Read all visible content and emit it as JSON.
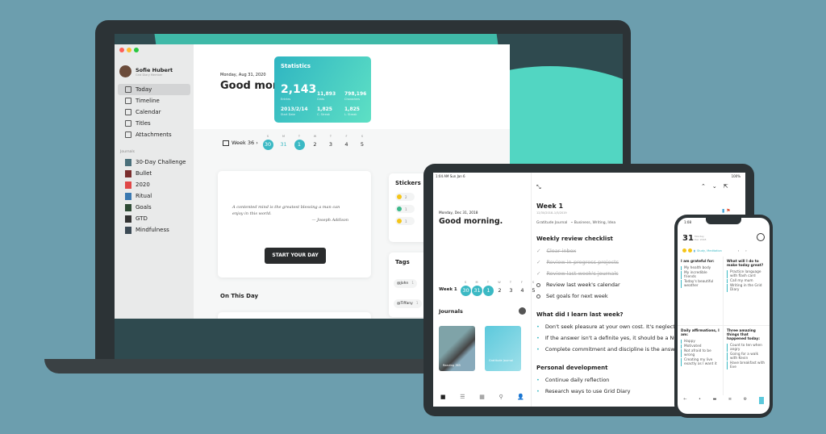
{
  "colors": {
    "background": "#6c9eae",
    "accent": "#3bb9c4",
    "bezel": "#2c3336"
  },
  "mac": {
    "window_controls": [
      "#fe5f57",
      "#febc2e",
      "#28c840"
    ],
    "user": {
      "name": "Sofie Hubert",
      "subtitle": "Grid Diary Member"
    },
    "nav": [
      {
        "label": "Today",
        "icon": "bookmark-icon",
        "active": true
      },
      {
        "label": "Timeline",
        "icon": "list-icon"
      },
      {
        "label": "Calendar",
        "icon": "calendar-icon"
      },
      {
        "label": "Titles",
        "icon": "sparkle-icon"
      },
      {
        "label": "Attachments",
        "icon": "image-icon"
      }
    ],
    "journals_heading": "Journals",
    "journals": [
      {
        "label": "30-Day Challenge",
        "color": "#4a6f7a"
      },
      {
        "label": "Bullet",
        "color": "#7a2e2e"
      },
      {
        "label": "2020",
        "color": "#e04848"
      },
      {
        "label": "Ritual",
        "color": "#3a78b0"
      },
      {
        "label": "Goals",
        "color": "#2d4a34"
      },
      {
        "label": "GTD",
        "color": "#333"
      },
      {
        "label": "Mindfulness",
        "color": "#3c4a55"
      }
    ],
    "date": "Monday, Aug 31, 2020",
    "greeting": "Good morning.",
    "week_label": "Week 36",
    "week_days": [
      {
        "l": "S",
        "d": "30",
        "sel": true
      },
      {
        "l": "M",
        "d": "31",
        "accent": true
      },
      {
        "l": "T",
        "d": "1",
        "sel": true
      },
      {
        "l": "W",
        "d": "2"
      },
      {
        "l": "T",
        "d": "3"
      },
      {
        "l": "F",
        "d": "4"
      },
      {
        "l": "S",
        "d": "5"
      }
    ],
    "quote": "A contented mind is the greatest blessing a man can enjoy in this world.",
    "quote_author": "— Joseph Addison",
    "start_button": "START YOUR DAY",
    "on_this_day": "On This Day",
    "stats": {
      "title": "Statistics",
      "entries": "2,143",
      "entries_label": "Entries",
      "grids": "11,893",
      "grids_label": "Grids",
      "characters": "798,196",
      "characters_label": "Characters",
      "start": "2013/2/14",
      "start_label": "Start Date",
      "cstreak": "1,825",
      "cstreak_label": "C. Streak",
      "lstreak": "1,825",
      "lstreak_label": "L. Streak"
    },
    "stickers": {
      "title": "Stickers",
      "items": [
        {
          "count": "2"
        },
        {
          "count": "1"
        },
        {
          "count": "1"
        }
      ]
    },
    "tags": {
      "title": "Tags",
      "items": [
        {
          "label": "@John",
          "count": "1"
        },
        {
          "label": "@Tiffany",
          "count": "1"
        }
      ]
    }
  },
  "ipad": {
    "status_time": "1:04 AM  Sun Jan 6",
    "battery": "100%",
    "date": "Monday, Dec 31, 2018",
    "greeting": "Good morning.",
    "week_label": "Week 1",
    "week_days": [
      {
        "l": "S",
        "d": "30",
        "sel": true
      },
      {
        "l": "M",
        "d": "31",
        "sel": true
      },
      {
        "l": "T",
        "d": "1",
        "sel": true
      },
      {
        "l": "W",
        "d": "2"
      },
      {
        "l": "T",
        "d": "3"
      },
      {
        "l": "F",
        "d": "4"
      },
      {
        "l": "S",
        "d": "5"
      }
    ],
    "journals_heading": "Journals",
    "journal_covers": [
      {
        "label": "Reading 365"
      },
      {
        "label": "Gratitude Journal"
      }
    ],
    "entry": {
      "title": "Week 1",
      "range": "12/30/2018–1/5/2019",
      "journal": "Gratitude Journal",
      "tags": "Business, Writing, Idea",
      "sections": [
        {
          "heading": "Weekly review checklist",
          "type": "check",
          "items": [
            {
              "t": "Clear inbox",
              "done": true
            },
            {
              "t": "Review in-progress projects",
              "done": true
            },
            {
              "t": "Review last week's journals",
              "done": true
            },
            {
              "t": "Review last week's calendar",
              "done": false
            },
            {
              "t": "Set goals for next week",
              "done": false
            }
          ]
        },
        {
          "heading": "What did I learn last week?",
          "type": "bullet",
          "items": [
            {
              "t": "Don't seek pleasure at your own cost. It's neglect."
            },
            {
              "t": "If the answer isn't a definite yes, it should be a NO."
            },
            {
              "t": "Complete commitment and discipline is the answer."
            }
          ]
        },
        {
          "heading": "Personal development",
          "type": "bullet",
          "items": [
            {
              "t": "Continue daily reflection"
            },
            {
              "t": "Research ways to use Grid Diary"
            }
          ]
        }
      ]
    }
  },
  "iphone": {
    "time": "1:08",
    "day": "31",
    "weekday": "Monday",
    "month": "Dec 2018",
    "tags": "Study, Meditation",
    "grids": [
      {
        "q": "I am grateful for:",
        "items": [
          "My health body",
          "My incredible friends",
          "Today's beautiful weather"
        ]
      },
      {
        "q": "What will I do to make today great?",
        "items": [
          "Practice language with flash card",
          "Call my mum",
          "Writing in the Grid Diary"
        ]
      },
      {
        "q": "Daily affirmations, I am:",
        "items": [
          "Happy",
          "Motivated",
          "Not afraid to be wrong",
          "Creating my live exactly as I want it"
        ]
      },
      {
        "q": "Three amazing things that happened today:",
        "items": [
          "Count to ten when angry",
          "Going for a walk with Kevin",
          "Have breakfast with Eve"
        ]
      }
    ]
  }
}
